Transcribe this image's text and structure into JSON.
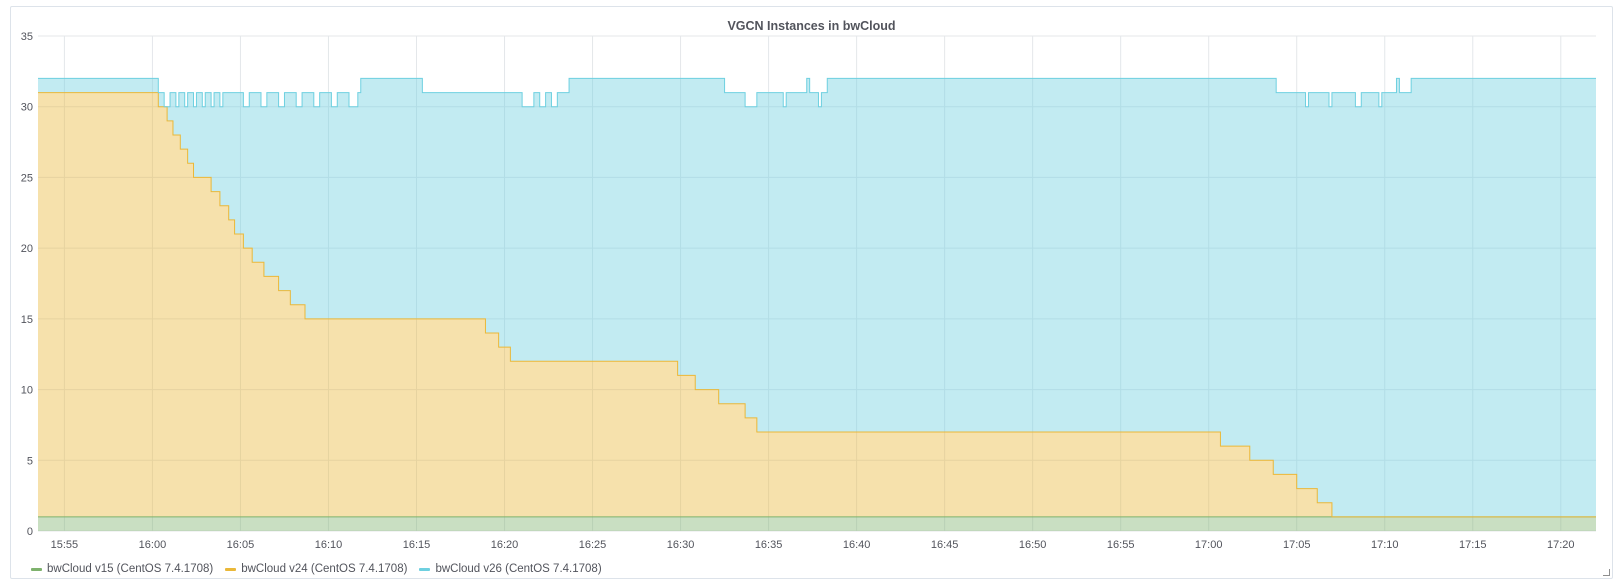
{
  "panel": {
    "title": "VGCN Instances in bwCloud"
  },
  "legend": [
    {
      "label": "bwCloud v15 (CentOS 7.4.1708)",
      "color": "#7eb26d"
    },
    {
      "label": "bwCloud v24 (CentOS 7.4.1708)",
      "color": "#eab839"
    },
    {
      "label": "bwCloud v26 (CentOS 7.4.1708)",
      "color": "#6ed0e0"
    }
  ],
  "chart_data": {
    "type": "area",
    "stacked": true,
    "step": true,
    "title": "VGCN Instances in bwCloud",
    "xlabel": "",
    "ylabel": "",
    "ylim": [
      0,
      35
    ],
    "yticks": [
      0,
      5,
      10,
      15,
      20,
      25,
      30,
      35
    ],
    "xlim": [
      "15:53:30",
      "17:22:00"
    ],
    "xticks": [
      "15:55",
      "16:00",
      "16:05",
      "16:10",
      "16:15",
      "16:20",
      "16:25",
      "16:30",
      "16:35",
      "16:40",
      "16:45",
      "16:50",
      "16:55",
      "17:00",
      "17:05",
      "17:10",
      "17:15",
      "17:20"
    ],
    "grid": true,
    "legend_position": "bottom-left",
    "series": [
      {
        "name": "bwCloud v15 (CentOS 7.4.1708)",
        "color": "#7eb26d",
        "points": [
          [
            "15:53:30",
            1
          ],
          [
            "17:22:00",
            1
          ]
        ]
      },
      {
        "name": "bwCloud v24 (CentOS 7.4.1708)",
        "color": "#eab839",
        "points": [
          [
            "15:53:30",
            30
          ],
          [
            "16:00:20",
            29
          ],
          [
            "16:00:50",
            28
          ],
          [
            "16:01:10",
            27
          ],
          [
            "16:01:35",
            26
          ],
          [
            "16:02:00",
            25
          ],
          [
            "16:02:20",
            24
          ],
          [
            "16:03:20",
            23
          ],
          [
            "16:03:50",
            22
          ],
          [
            "16:04:20",
            21
          ],
          [
            "16:04:40",
            20
          ],
          [
            "16:05:10",
            19
          ],
          [
            "16:05:40",
            18
          ],
          [
            "16:06:20",
            17
          ],
          [
            "16:07:10",
            16
          ],
          [
            "16:07:50",
            15
          ],
          [
            "16:08:40",
            14
          ],
          [
            "16:18:55",
            13
          ],
          [
            "16:19:40",
            12
          ],
          [
            "16:20:20",
            11
          ],
          [
            "16:29:50",
            10
          ],
          [
            "16:30:50",
            9
          ],
          [
            "16:32:10",
            8
          ],
          [
            "16:33:40",
            7
          ],
          [
            "16:34:20",
            6
          ],
          [
            "17:00:40",
            5
          ],
          [
            "17:02:20",
            4
          ],
          [
            "17:03:40",
            3
          ],
          [
            "17:05:00",
            2
          ],
          [
            "17:06:10",
            1
          ],
          [
            "17:07:00",
            0
          ],
          [
            "17:22:00",
            0
          ]
        ]
      },
      {
        "name": "bwCloud v26 (CentOS 7.4.1708)",
        "color": "#6ed0e0",
        "stacked_total": [
          [
            "15:53:30",
            32
          ],
          [
            "16:00:20",
            31
          ],
          [
            "16:00:40",
            30
          ],
          [
            "16:01:00",
            31
          ],
          [
            "16:01:20",
            30
          ],
          [
            "16:01:30",
            31
          ],
          [
            "16:01:50",
            30
          ],
          [
            "16:02:00",
            31
          ],
          [
            "16:02:20",
            30
          ],
          [
            "16:02:30",
            31
          ],
          [
            "16:02:50",
            30
          ],
          [
            "16:03:00",
            31
          ],
          [
            "16:03:20",
            30
          ],
          [
            "16:03:30",
            31
          ],
          [
            "16:03:50",
            30
          ],
          [
            "16:04:00",
            31
          ],
          [
            "16:05:10",
            30
          ],
          [
            "16:05:30",
            31
          ],
          [
            "16:06:10",
            30
          ],
          [
            "16:06:30",
            31
          ],
          [
            "16:07:10",
            30
          ],
          [
            "16:07:30",
            31
          ],
          [
            "16:08:10",
            30
          ],
          [
            "16:08:30",
            31
          ],
          [
            "16:09:10",
            30
          ],
          [
            "16:09:30",
            31
          ],
          [
            "16:10:10",
            30
          ],
          [
            "16:10:30",
            31
          ],
          [
            "16:11:10",
            30
          ],
          [
            "16:11:40",
            31
          ],
          [
            "16:11:50",
            32
          ],
          [
            "16:15:20",
            31
          ],
          [
            "16:21:00",
            30
          ],
          [
            "16:21:40",
            31
          ],
          [
            "16:22:00",
            30
          ],
          [
            "16:22:20",
            31
          ],
          [
            "16:22:40",
            30
          ],
          [
            "16:23:00",
            31
          ],
          [
            "16:23:40",
            32
          ],
          [
            "16:32:30",
            31
          ],
          [
            "16:33:40",
            30
          ],
          [
            "16:34:20",
            31
          ],
          [
            "16:35:50",
            30
          ],
          [
            "16:36:00",
            31
          ],
          [
            "16:37:10",
            32
          ],
          [
            "16:37:20",
            31
          ],
          [
            "16:37:50",
            30
          ],
          [
            "16:38:00",
            31
          ],
          [
            "16:38:20",
            32
          ],
          [
            "17:03:50",
            31
          ],
          [
            "17:05:30",
            30
          ],
          [
            "17:05:40",
            31
          ],
          [
            "17:06:50",
            30
          ],
          [
            "17:07:00",
            31
          ],
          [
            "17:08:20",
            30
          ],
          [
            "17:08:40",
            31
          ],
          [
            "17:09:40",
            30
          ],
          [
            "17:09:50",
            31
          ],
          [
            "17:10:40",
            32
          ],
          [
            "17:10:50",
            31
          ],
          [
            "17:11:30",
            32
          ],
          [
            "17:22:00",
            32
          ]
        ]
      }
    ]
  }
}
